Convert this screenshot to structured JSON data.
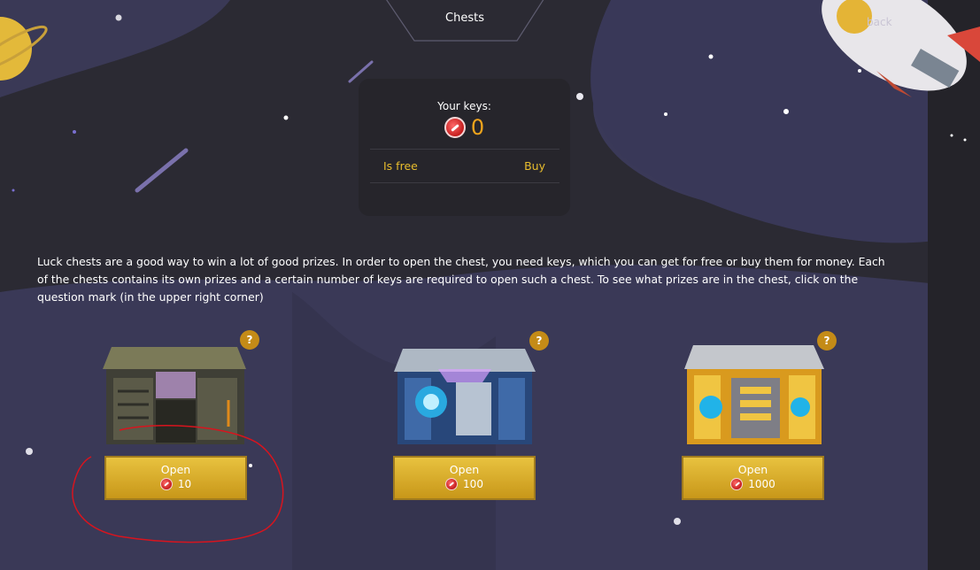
{
  "header": {
    "title": "Chests",
    "back_label": "back"
  },
  "keys_panel": {
    "label": "Your keys:",
    "count": "0",
    "free_label": "Is free",
    "buy_label": "Buy"
  },
  "description": "Luck chests are a good way to win a lot of good prizes. In order to open the chest, you need keys, which you can get for free or buy them for money. Each of the chests contains its own prizes and a certain number of keys are required to open such a chest. To see what prizes are in the chest, click on the question mark (in the upper right corner)",
  "chests": [
    {
      "name": "dark-chest",
      "open_label": "Open",
      "price": "10",
      "info": "?"
    },
    {
      "name": "blue-chest",
      "open_label": "Open",
      "price": "100",
      "info": "?"
    },
    {
      "name": "gold-chest",
      "open_label": "Open",
      "price": "1000",
      "info": "?"
    }
  ],
  "colors": {
    "background": "#2a2833",
    "panel": "#26252b",
    "accent_gold": "#e8bd2d",
    "keys_count": "#f0a41c",
    "annotation_red": "#d8141e"
  }
}
